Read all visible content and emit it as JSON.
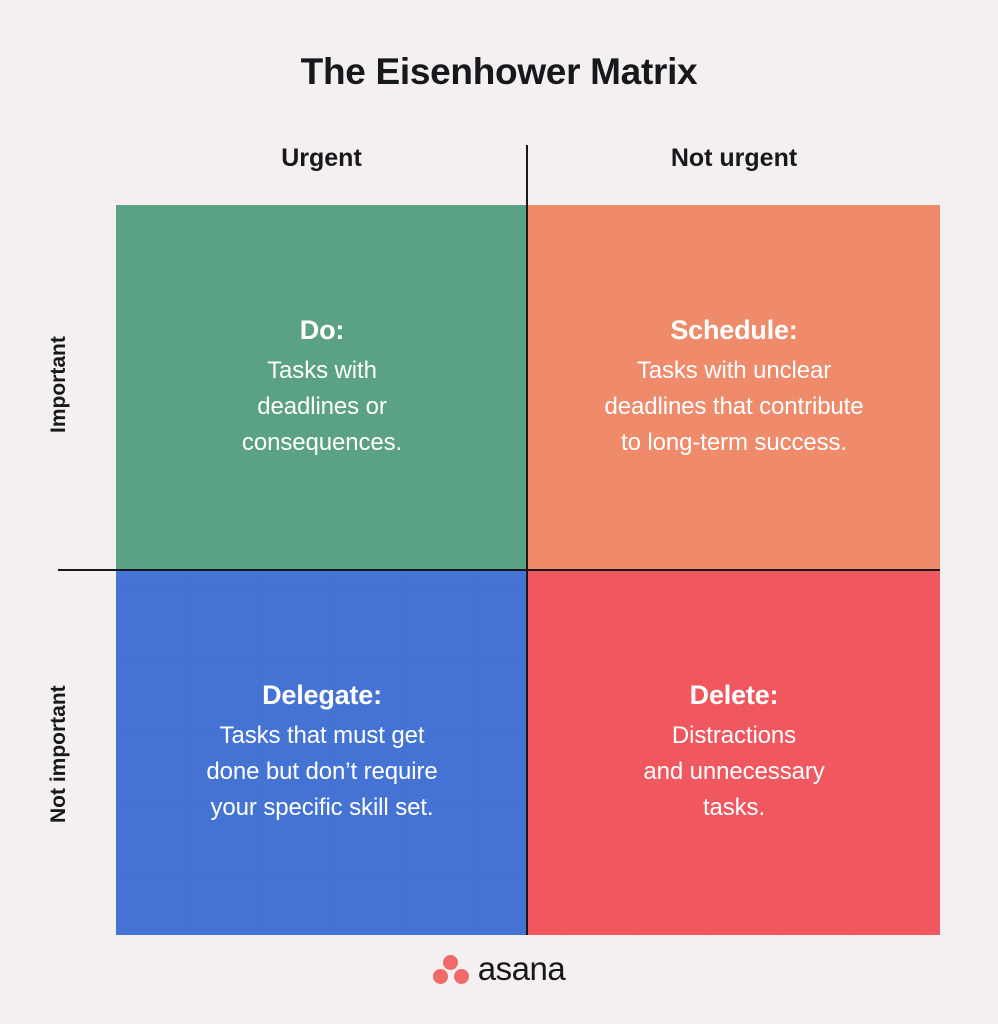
{
  "page": {
    "title": "The Eisenhower Matrix",
    "background_color": "#f4eff1"
  },
  "axes": {
    "columns": [
      {
        "label": "Urgent"
      },
      {
        "label": "Not urgent"
      }
    ],
    "rows": [
      {
        "label": "Important"
      },
      {
        "label": "Not important"
      }
    ]
  },
  "quadrants": [
    {
      "id": "do",
      "title": "Do:",
      "body": "Tasks with deadlines or consequences.",
      "color": "#5ba183",
      "row": "Important",
      "column": "Urgent"
    },
    {
      "id": "schedule",
      "title": "Schedule:",
      "body": "Tasks with unclear deadlines that contribute to long-term success.",
      "color": "#ef8b6b",
      "row": "Important",
      "column": "Not urgent"
    },
    {
      "id": "delegate",
      "title": "Delegate:",
      "body": "Tasks that must get done but don’t require your specific skill set.",
      "color": "#4473d4",
      "row": "Not important",
      "column": "Urgent"
    },
    {
      "id": "delete",
      "title": "Delete:",
      "body": "Distractions and unnecessary tasks.",
      "color": "#f0575f",
      "row": "Not important",
      "column": "Not urgent"
    }
  ],
  "chart_data": {
    "type": "table",
    "title": "The Eisenhower Matrix",
    "xlabel": "",
    "ylabel": "",
    "categories": [
      "Urgent",
      "Not urgent"
    ],
    "rows": [
      "Important",
      "Not important"
    ],
    "cells": [
      [
        {
          "title": "Do:",
          "body": "Tasks with deadlines or consequences.",
          "color": "#5ba183"
        },
        {
          "title": "Schedule:",
          "body": "Tasks with unclear deadlines that contribute to long-term success.",
          "color": "#ef8b6b"
        }
      ],
      [
        {
          "title": "Delegate:",
          "body": "Tasks that must get done but don’t require your specific skill set.",
          "color": "#4473d4"
        },
        {
          "title": "Delete:",
          "body": "Distractions and unnecessary tasks.",
          "color": "#f0575f"
        }
      ]
    ],
    "grid": false,
    "legend": "none"
  },
  "quadrant_lines": [
    {
      "title_line": "Do:",
      "lines": [
        "Tasks with",
        "deadlines or",
        "consequences."
      ]
    },
    {
      "title_line": "Schedule:",
      "lines": [
        "Tasks with unclear",
        "deadlines that contribute",
        "to long-term success."
      ]
    },
    {
      "title_line": "Delegate:",
      "lines": [
        "Tasks that must get",
        "done but don’t require",
        "your specific skill set."
      ]
    },
    {
      "title_line": "Delete:",
      "lines": [
        "Distractions",
        "and unnecessary",
        "tasks."
      ]
    }
  ],
  "branding": {
    "wordmark": "asana",
    "logo_color": "#f06a6a",
    "dot_names": [
      "logo-dot-top",
      "logo-dot-left",
      "logo-dot-right"
    ]
  }
}
